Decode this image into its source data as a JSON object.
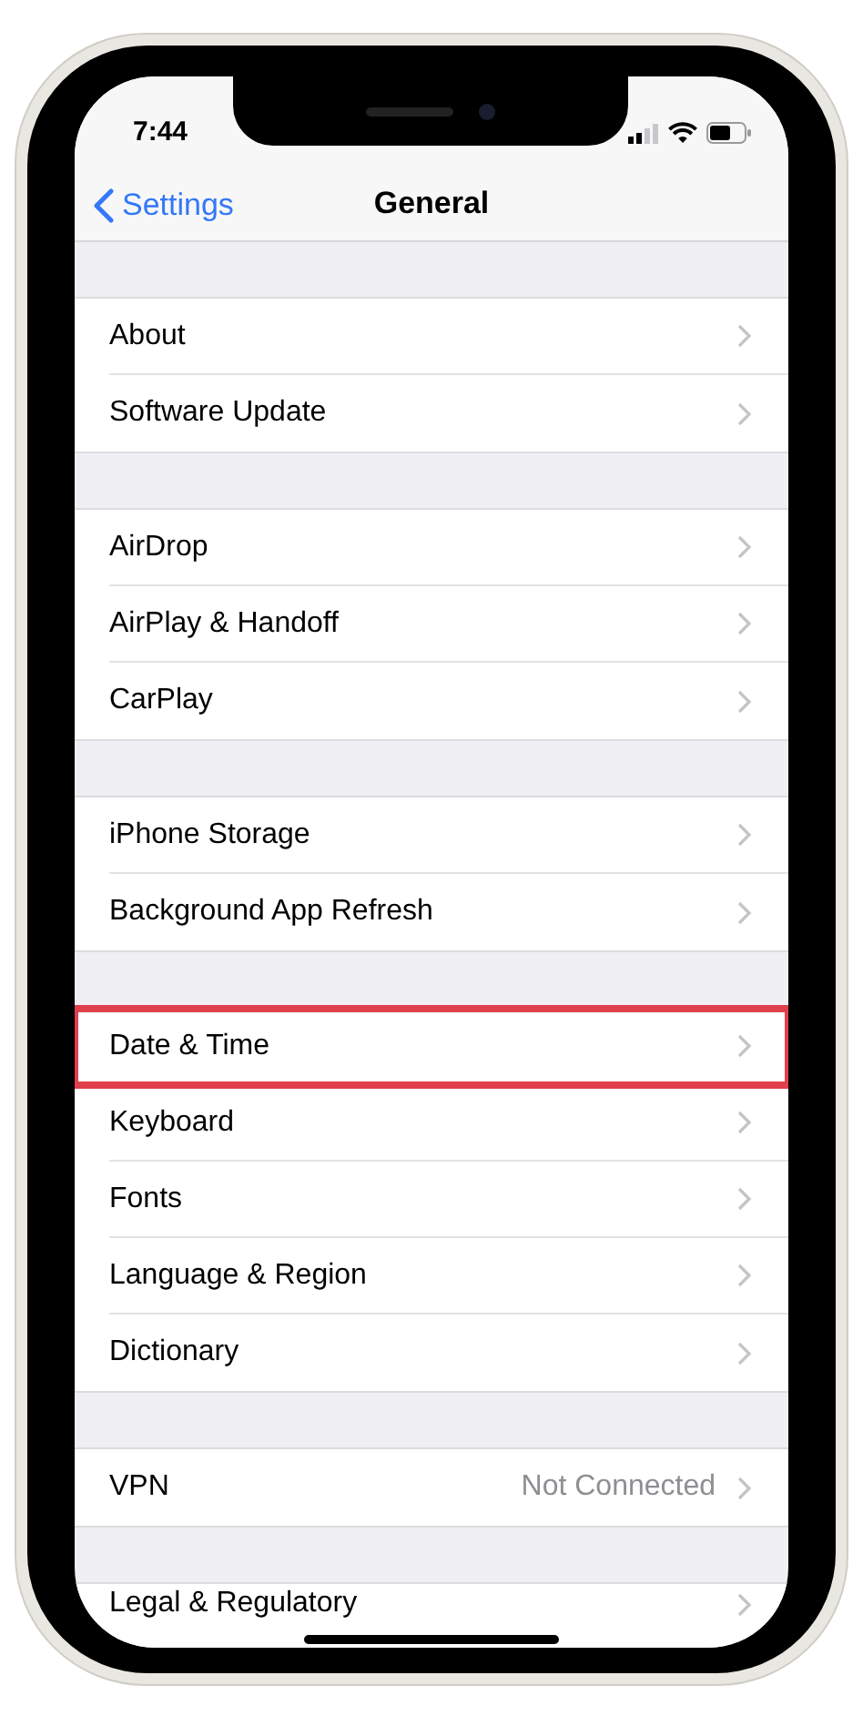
{
  "status_bar": {
    "time": "7:44"
  },
  "nav": {
    "back": "Settings",
    "title": "General"
  },
  "groups": [
    {
      "rows": [
        {
          "label": "About",
          "highlighted": false
        },
        {
          "label": "Software Update",
          "highlighted": false
        }
      ]
    },
    {
      "rows": [
        {
          "label": "AirDrop",
          "highlighted": false
        },
        {
          "label": "AirPlay & Handoff",
          "highlighted": false
        },
        {
          "label": "CarPlay",
          "highlighted": false
        }
      ]
    },
    {
      "rows": [
        {
          "label": "iPhone Storage",
          "highlighted": false
        },
        {
          "label": "Background App Refresh",
          "highlighted": false
        }
      ]
    },
    {
      "rows": [
        {
          "label": "Date & Time",
          "highlighted": true
        },
        {
          "label": "Keyboard",
          "highlighted": false
        },
        {
          "label": "Fonts",
          "highlighted": false
        },
        {
          "label": "Language & Region",
          "highlighted": false
        },
        {
          "label": "Dictionary",
          "highlighted": false
        }
      ]
    },
    {
      "rows": [
        {
          "label": "VPN",
          "value": "Not Connected",
          "highlighted": false
        }
      ]
    },
    {
      "rows": [
        {
          "label": "Legal & Regulatory",
          "highlighted": false
        }
      ]
    }
  ]
}
